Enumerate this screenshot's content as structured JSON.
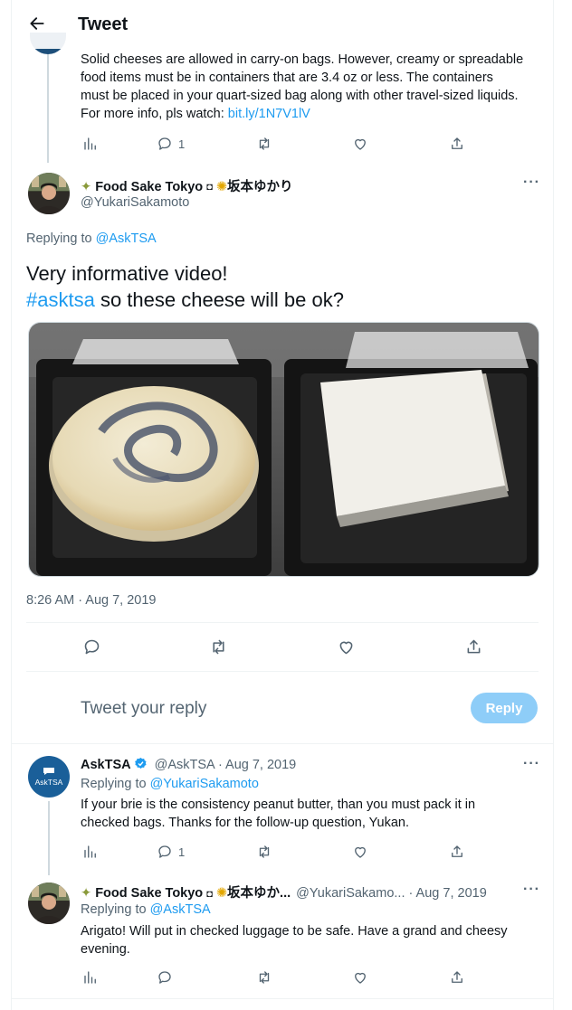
{
  "header": {
    "title": "Tweet"
  },
  "parent_tweet": {
    "text_lines": [
      "Solid cheeses are allowed in carry-on bags. However, creamy or spreadable",
      "food items must be in containers that are 3.4 oz or less. The containers",
      "must be placed in your quart-sized bag along with other travel-sized liquids."
    ],
    "last_line_prefix": "For more info, pls watch: ",
    "link": "bit.ly/1N7V1lV",
    "reply_count": "1"
  },
  "main_tweet": {
    "display_name": "Food Sake Tokyo",
    "name_extra": "坂本ゆかり",
    "handle": "@YukariSakamoto",
    "replying_prefix": "Replying to ",
    "replying_to": "@AskTSA",
    "text_line1": "Very informative video!",
    "hashtag": "#asktsa",
    "text_line2_rest": " so these cheese will be ok?",
    "timestamp": "8:26 AM · Aug 7, 2019"
  },
  "reply_box": {
    "placeholder": "Tweet your reply",
    "button": "Reply"
  },
  "reply1": {
    "display_name": "AskTSA",
    "handle_date": "@AskTSA · Aug 7, 2019",
    "avatar_text": "AskTSA",
    "replying_prefix": "Replying to ",
    "replying_to": "@YukariSakamoto",
    "text_line1": "If your brie is the consistency peanut butter, than you must pack it in",
    "text_line2": "checked bags. Thanks for the follow-up question, Yukan.",
    "reply_count": "1"
  },
  "reply2": {
    "display_name": "Food Sake Tokyo",
    "name_extra": "坂本ゆか...",
    "handle_date": "@YukariSakamo... · Aug 7, 2019",
    "replying_prefix": "Replying to ",
    "replying_to": "@AskTSA",
    "text_line1": "Arigato! Will put in checked luggage to be safe. Have a grand and cheesy",
    "text_line2": "evening."
  },
  "colors": {
    "accent": "#1d9bf0",
    "text": "#0f1419",
    "muted": "#536471",
    "reply_button": "#8ecdf8"
  }
}
